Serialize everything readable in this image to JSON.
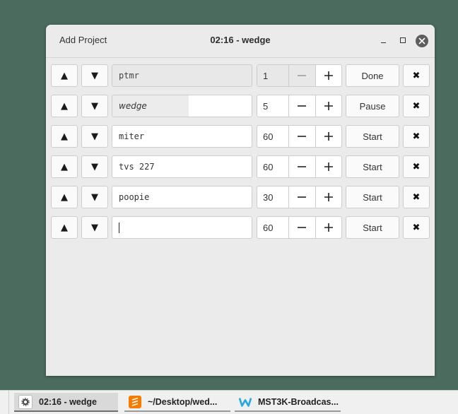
{
  "window": {
    "title": "02:16 - wedge",
    "add_project_label": "Add Project"
  },
  "icons": {
    "up": "▲",
    "down": "▼",
    "delete": "✖"
  },
  "projects": [
    {
      "name": "ptmr",
      "count": "1",
      "action": "Done",
      "state": "disabled"
    },
    {
      "name": "wedge",
      "count": "5",
      "action": "Pause",
      "state": "active"
    },
    {
      "name": "miter",
      "count": "60",
      "action": "Start",
      "state": "normal"
    },
    {
      "name": "tvs 227",
      "count": "60",
      "action": "Start",
      "state": "normal"
    },
    {
      "name": "poopie",
      "count": "30",
      "action": "Start",
      "state": "normal"
    },
    {
      "name": "",
      "count": "60",
      "action": "Start",
      "state": "editing"
    }
  ],
  "taskbar": {
    "items": [
      {
        "label": "02:16 - wedge",
        "icon": "gear-icon"
      },
      {
        "label": "~/Desktop/wed...",
        "icon": "sublime-text-icon",
        "color": "#f57c00"
      },
      {
        "label": "MST3K-Broadcas...",
        "icon": "browser-w-icon",
        "color": "#29a8e0"
      }
    ]
  },
  "colors": {
    "desktop": "#4a6b5e",
    "window_bg": "#ebebeb",
    "close_button": "#5e5e5e"
  }
}
